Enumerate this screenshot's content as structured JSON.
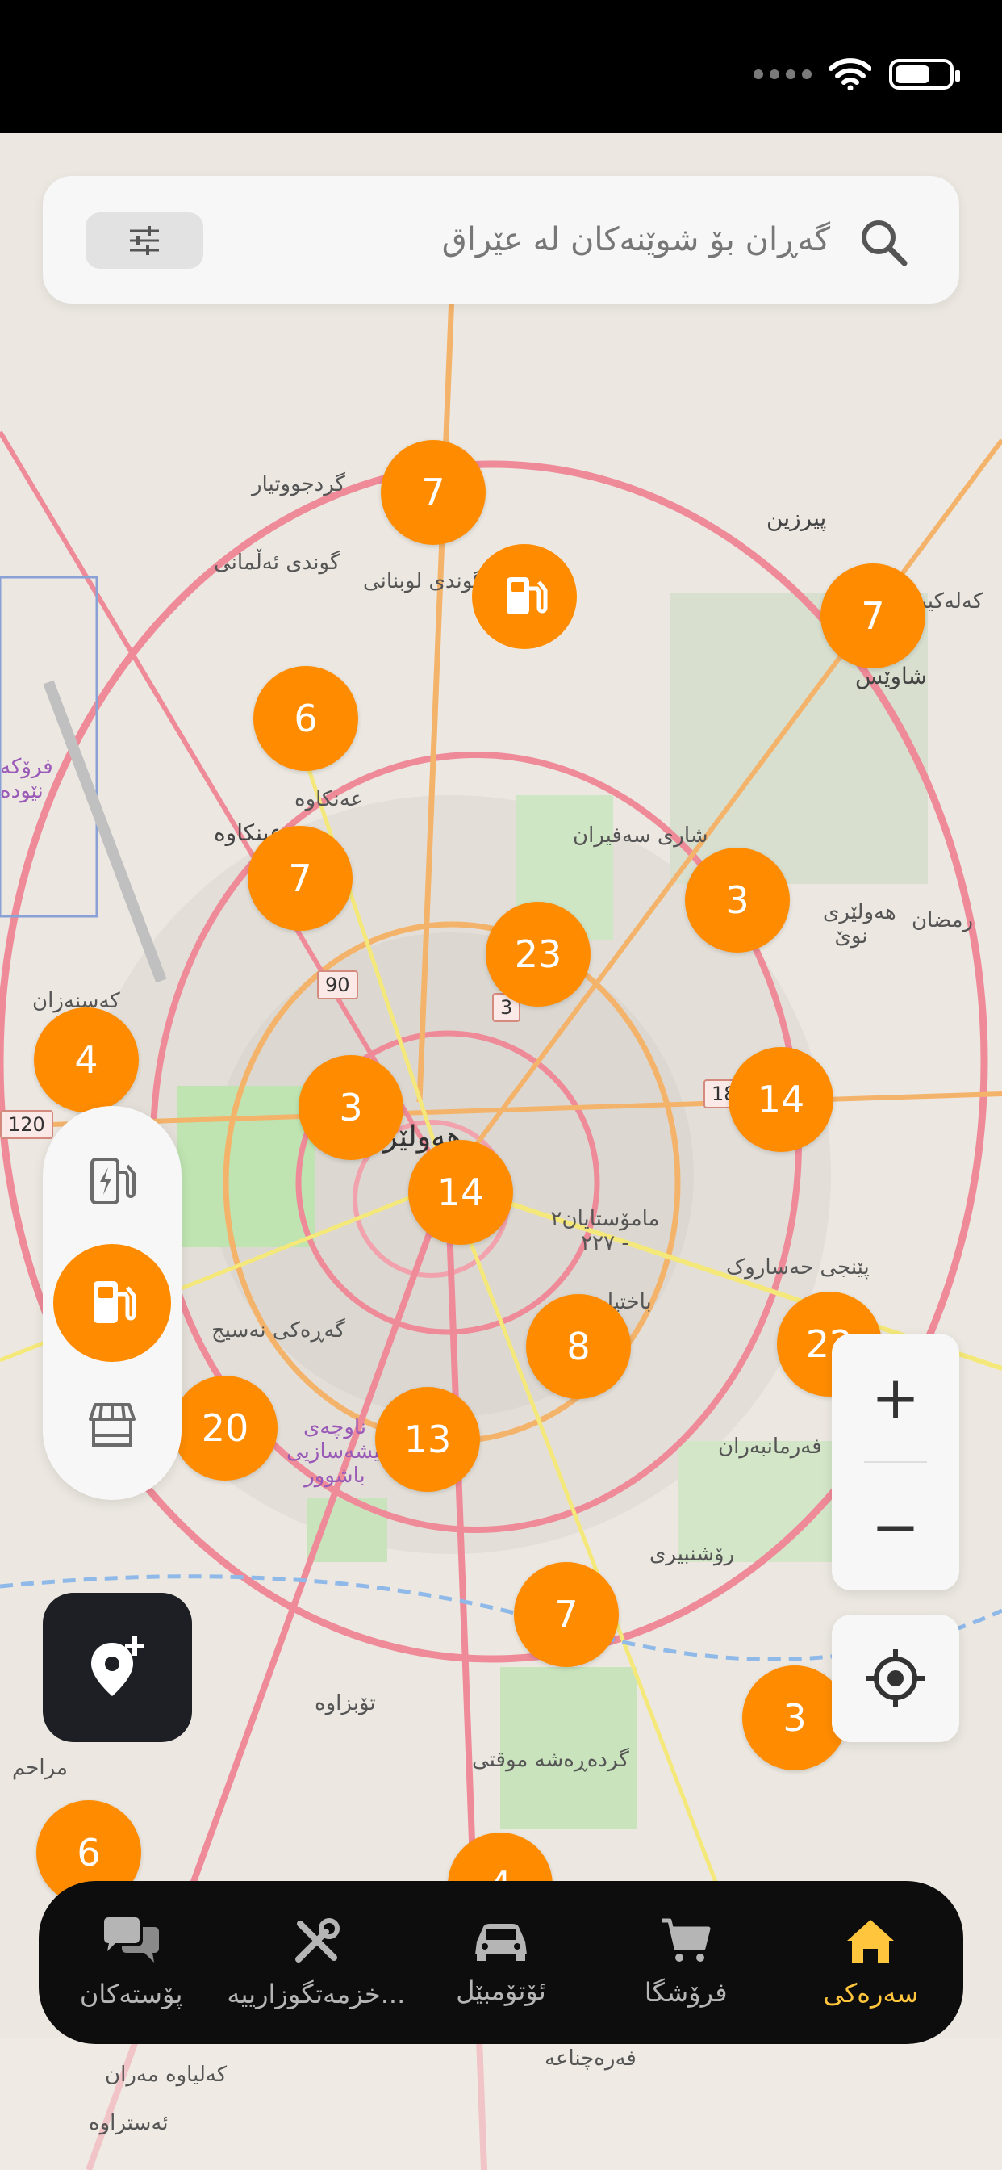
{
  "search": {
    "placeholder": "گەڕان بۆ شوێنەکان لە عێراق"
  },
  "map": {
    "labels": {
      "pirzin": "پیرزین",
      "shaways": "شاوێس",
      "gundi_lubnani": "گوندی لوبنانی",
      "gundi_alamani": "گوندی ئەڵمانی",
      "gurdjuwtiyar": "گردجووتیار",
      "ankawa": "عەنکاوە",
      "ankawa_big": "عينكاوه",
      "shari_safiran": "شاری سەفیران",
      "hawlery_nwe": "هەولێری نوێ",
      "hawler": "هەولێر",
      "mamostayan": "مامۆستایان٢ - ٢٢٧",
      "penji_hasarok": "پێنجی حەساروک",
      "garaki_nasej": "گەڕەکی نەسیج",
      "farmanbaran": "فەرمانبەران",
      "pishasazi": "ناوچەی پیشەسازیی باشوور",
      "roshnbiri": "رۆشنبیری",
      "tuzawa": "تۆبزاوە",
      "garda_rasha": "گردەڕەشە موقتی",
      "mrahim": "مراحم",
      "kalakin": "كەلەكين",
      "farokhana": "فرۆکە نێودە",
      "kasanazan": "كەسنەزان",
      "farajnaa": "فەرەچناعە",
      "kalyawa": "کەلیاوە مەران",
      "astrawa": "ئەستراوە",
      "ramadan": "رمضان",
      "bakhtiyari": "باختیاری"
    },
    "road_shields": [
      "90",
      "3",
      "120",
      "18"
    ],
    "clusters": [
      "7",
      "7",
      "6",
      "7",
      "3",
      "23",
      "4",
      "3",
      "14",
      "14",
      "8",
      "20",
      "13",
      "22",
      "7",
      "3",
      "6",
      "4"
    ]
  },
  "station_types": [
    "ev-charging",
    "fuel",
    "store"
  ],
  "zoom": {
    "in": "+",
    "out": "−"
  },
  "nav": {
    "items": [
      {
        "label": "پۆستەکان",
        "icon": "chat-icon"
      },
      {
        "label": "خزمەتگوزارییە...",
        "icon": "tools-icon"
      },
      {
        "label": "ئۆتۆمبێل",
        "icon": "car-icon"
      },
      {
        "label": "فرۆشگا",
        "icon": "cart-icon"
      },
      {
        "label": "سەرەکی",
        "icon": "home-icon"
      }
    ],
    "active_color": "#ffc53d"
  },
  "colors": {
    "accent": "#ff8c00",
    "nav_bg": "#0d0d0d",
    "fab_bg": "#1d1f24"
  }
}
